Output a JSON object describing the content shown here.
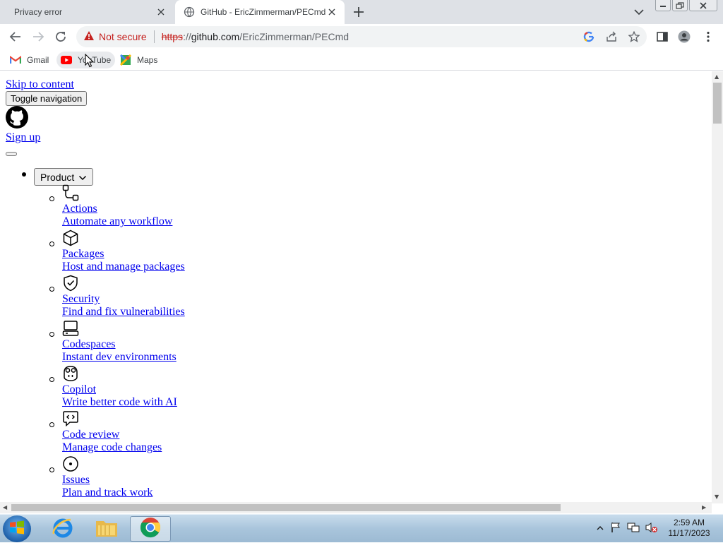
{
  "browser": {
    "tabs": [
      {
        "title": "Privacy error",
        "active": false
      },
      {
        "title": "GitHub - EricZimmerman/PECmd",
        "active": true
      }
    ],
    "address": {
      "security_label": "Not secure",
      "scheme": "https",
      "rest": "://",
      "host": "github.com",
      "path": "/EricZimmerman/PECmd"
    },
    "bookmarks": [
      {
        "label": "Gmail",
        "icon": "gmail-icon"
      },
      {
        "label": "YouTube",
        "icon": "youtube-icon"
      },
      {
        "label": "Maps",
        "icon": "maps-icon"
      }
    ]
  },
  "page": {
    "skip_link": "Skip to content",
    "toggle_nav": "Toggle navigation",
    "sign_up": "Sign up",
    "product_button": "Product",
    "product_items": [
      {
        "title": "Actions",
        "desc": "Automate any workflow",
        "icon": "workflow-icon"
      },
      {
        "title": "Packages",
        "desc": "Host and manage packages",
        "icon": "package-icon"
      },
      {
        "title": "Security",
        "desc": "Find and fix vulnerabilities",
        "icon": "shield-check-icon"
      },
      {
        "title": "Codespaces",
        "desc": "Instant dev environments",
        "icon": "codespaces-icon"
      },
      {
        "title": "Copilot",
        "desc": "Write better code with AI",
        "icon": "copilot-icon"
      },
      {
        "title": "Code review",
        "desc": "Manage code changes",
        "icon": "code-review-icon"
      },
      {
        "title": "Issues",
        "desc": "Plan and track work",
        "icon": "issue-icon"
      }
    ]
  },
  "taskbar": {
    "apps": [
      "internet-explorer-icon",
      "file-explorer-icon",
      "chrome-icon"
    ],
    "time": "2:59 AM",
    "date": "11/17/2023"
  },
  "colors": {
    "link": "#0000ee",
    "not_secure": "#c5221f",
    "tabstrip": "#dee1e6"
  }
}
